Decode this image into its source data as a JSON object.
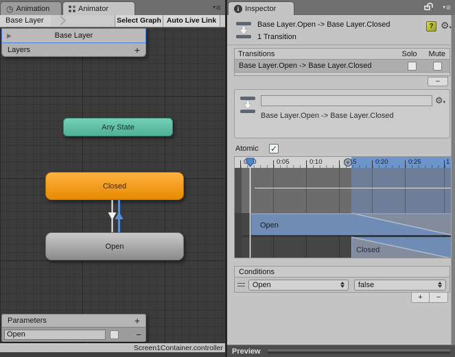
{
  "animator_panel": {
    "tabs": {
      "animation": "Animation",
      "animator": "Animator"
    },
    "breadcrumb": "Base Layer",
    "toolbar": {
      "select_graph": "Select Graph",
      "auto_live_link": "Auto Live Link"
    },
    "layers": {
      "selected_layer": "Base Layer",
      "header": "Layers",
      "add": "+"
    },
    "nodes": {
      "any_state": "Any State",
      "closed": "Closed",
      "open": "Open"
    },
    "parameters": {
      "header": "Parameters",
      "add": "+",
      "param_value": "Open",
      "remove": "−"
    },
    "status": "Screen1Container.controller"
  },
  "inspector": {
    "tab": "Inspector",
    "title": "Base Layer.Open -> Base Layer.Closed",
    "subtitle": "1 Transition",
    "transitions": {
      "header": "Transitions",
      "solo": "Solo",
      "mute": "Mute",
      "row_label": "Base Layer.Open -> Base Layer.Closed",
      "remove": "−"
    },
    "detail": {
      "name_value": "",
      "label": "Base Layer.Open -> Base Layer.Closed"
    },
    "atomic": {
      "label": "Atomic",
      "checked": true
    },
    "timeline": {
      "ruler_labels": [
        "0:00",
        "0:05",
        "0:10",
        "0:15",
        "0:20",
        "0:25",
        "1"
      ],
      "playhead_time": "0:00",
      "transition_start": "0:15",
      "bars": {
        "from": "Open",
        "to": "Closed"
      }
    },
    "conditions": {
      "header": "Conditions",
      "rows": [
        {
          "parameter": "Open",
          "value": "false"
        }
      ],
      "add": "+",
      "remove": "−"
    },
    "preview": {
      "label": "Preview"
    }
  },
  "icons": {
    "check": "✓",
    "help": "?",
    "play": "▶",
    "gear": "⚙",
    "menu": "≡",
    "menu_arrow": "▾",
    "clock": "◷",
    "info": "i",
    "plus": "+",
    "minus": "−"
  },
  "colors": {
    "selection_blue": "#4a7fe0",
    "node_teal": "#5fc2a6",
    "node_orange": "#f29b0d",
    "node_gray": "#a8a8a8",
    "timeline_blue": "#6d95cb",
    "bar_blue": "#6f8cb4",
    "graph_bg": "#3c3c3c",
    "inspector_bg": "#c4c4c4"
  }
}
